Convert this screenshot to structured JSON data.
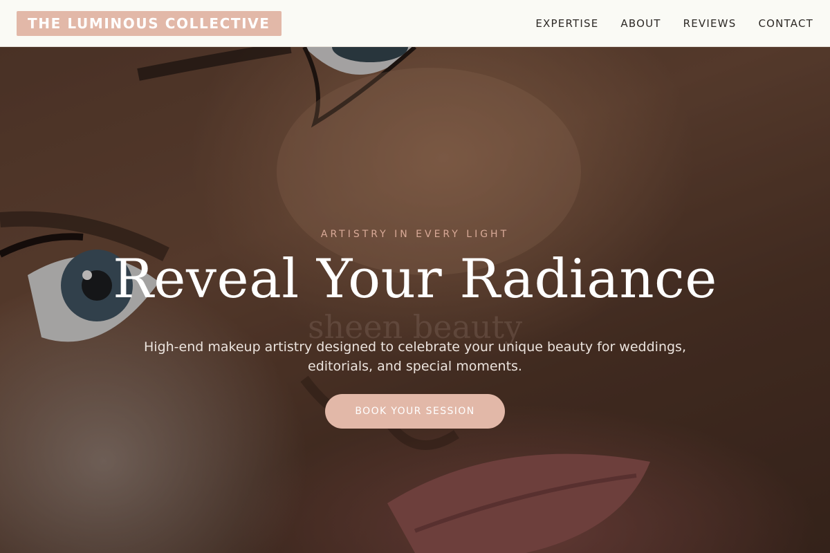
{
  "header": {
    "brand": "THE LUMINOUS COLLECTIVE",
    "nav": [
      {
        "label": "EXPERTISE"
      },
      {
        "label": "ABOUT"
      },
      {
        "label": "REVIEWS"
      },
      {
        "label": "CONTACT"
      }
    ]
  },
  "hero": {
    "eyebrow": "ARTISTRY IN EVERY LIGHT",
    "headline": "Reveal Your Radiance",
    "watermark": "sheen beauty",
    "subtitle": "High-end makeup artistry designed to celebrate your unique beauty for weddings, editorials, and special moments.",
    "cta": "BOOK YOUR SESSION",
    "photo_alt": "close-up of face with blue eyes"
  },
  "colors": {
    "accent": "#e2b8a8",
    "header_bg": "#fafaf5",
    "nav_text": "#2c2824",
    "eyebrow": "#d9aa98",
    "hero_text": "#ffffff"
  }
}
